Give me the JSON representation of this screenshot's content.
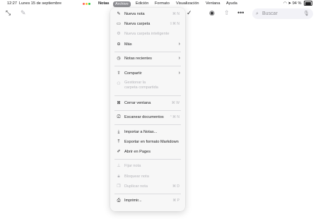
{
  "status": {
    "time": "12:27",
    "date": "Lunes 15 de septiembre",
    "battery": "94 %"
  },
  "menubar": {
    "app": "Notas",
    "items": [
      "Archivo",
      "Edición",
      "Formato",
      "Visualización",
      "Ventana",
      "Ayuda"
    ]
  },
  "toolbar": {
    "search_placeholder": "Buscar"
  },
  "menu": {
    "nueva_nota": {
      "label": "Nueva nota",
      "shortcut": "⌘ N"
    },
    "nueva_carpeta": {
      "label": "Nueva carpeta",
      "shortcut": "⇧⌘ N"
    },
    "nueva_carpeta_int": {
      "label": "Nueva carpeta inteligente"
    },
    "mas": {
      "label": "Más"
    },
    "notas_recientes": {
      "label": "Notas recientes"
    },
    "compartir": {
      "label": "Compartir"
    },
    "gestionar_1": {
      "label": "Gestionar la"
    },
    "gestionar_2": {
      "label": "carpeta compartida"
    },
    "cerrar_ventana": {
      "label": "Cerrar ventana",
      "shortcut": "⌘ W"
    },
    "escanear": {
      "label": "Escanear documentos",
      "shortcut": "⌃⌘ N"
    },
    "importar": {
      "label": "Importar a Notas..."
    },
    "exportar": {
      "label": "Exportar en formato Markdown"
    },
    "abrir_pages": {
      "label": "Abrir en Pages"
    },
    "fijar": {
      "label": "Fijar nota"
    },
    "bloquear": {
      "label": "Bloquear nota"
    },
    "duplicar": {
      "label": "Duplicar nota",
      "shortcut": "⌘ D"
    },
    "imprimir": {
      "label": "Imprimir...",
      "shortcut": "⌘ P"
    }
  }
}
